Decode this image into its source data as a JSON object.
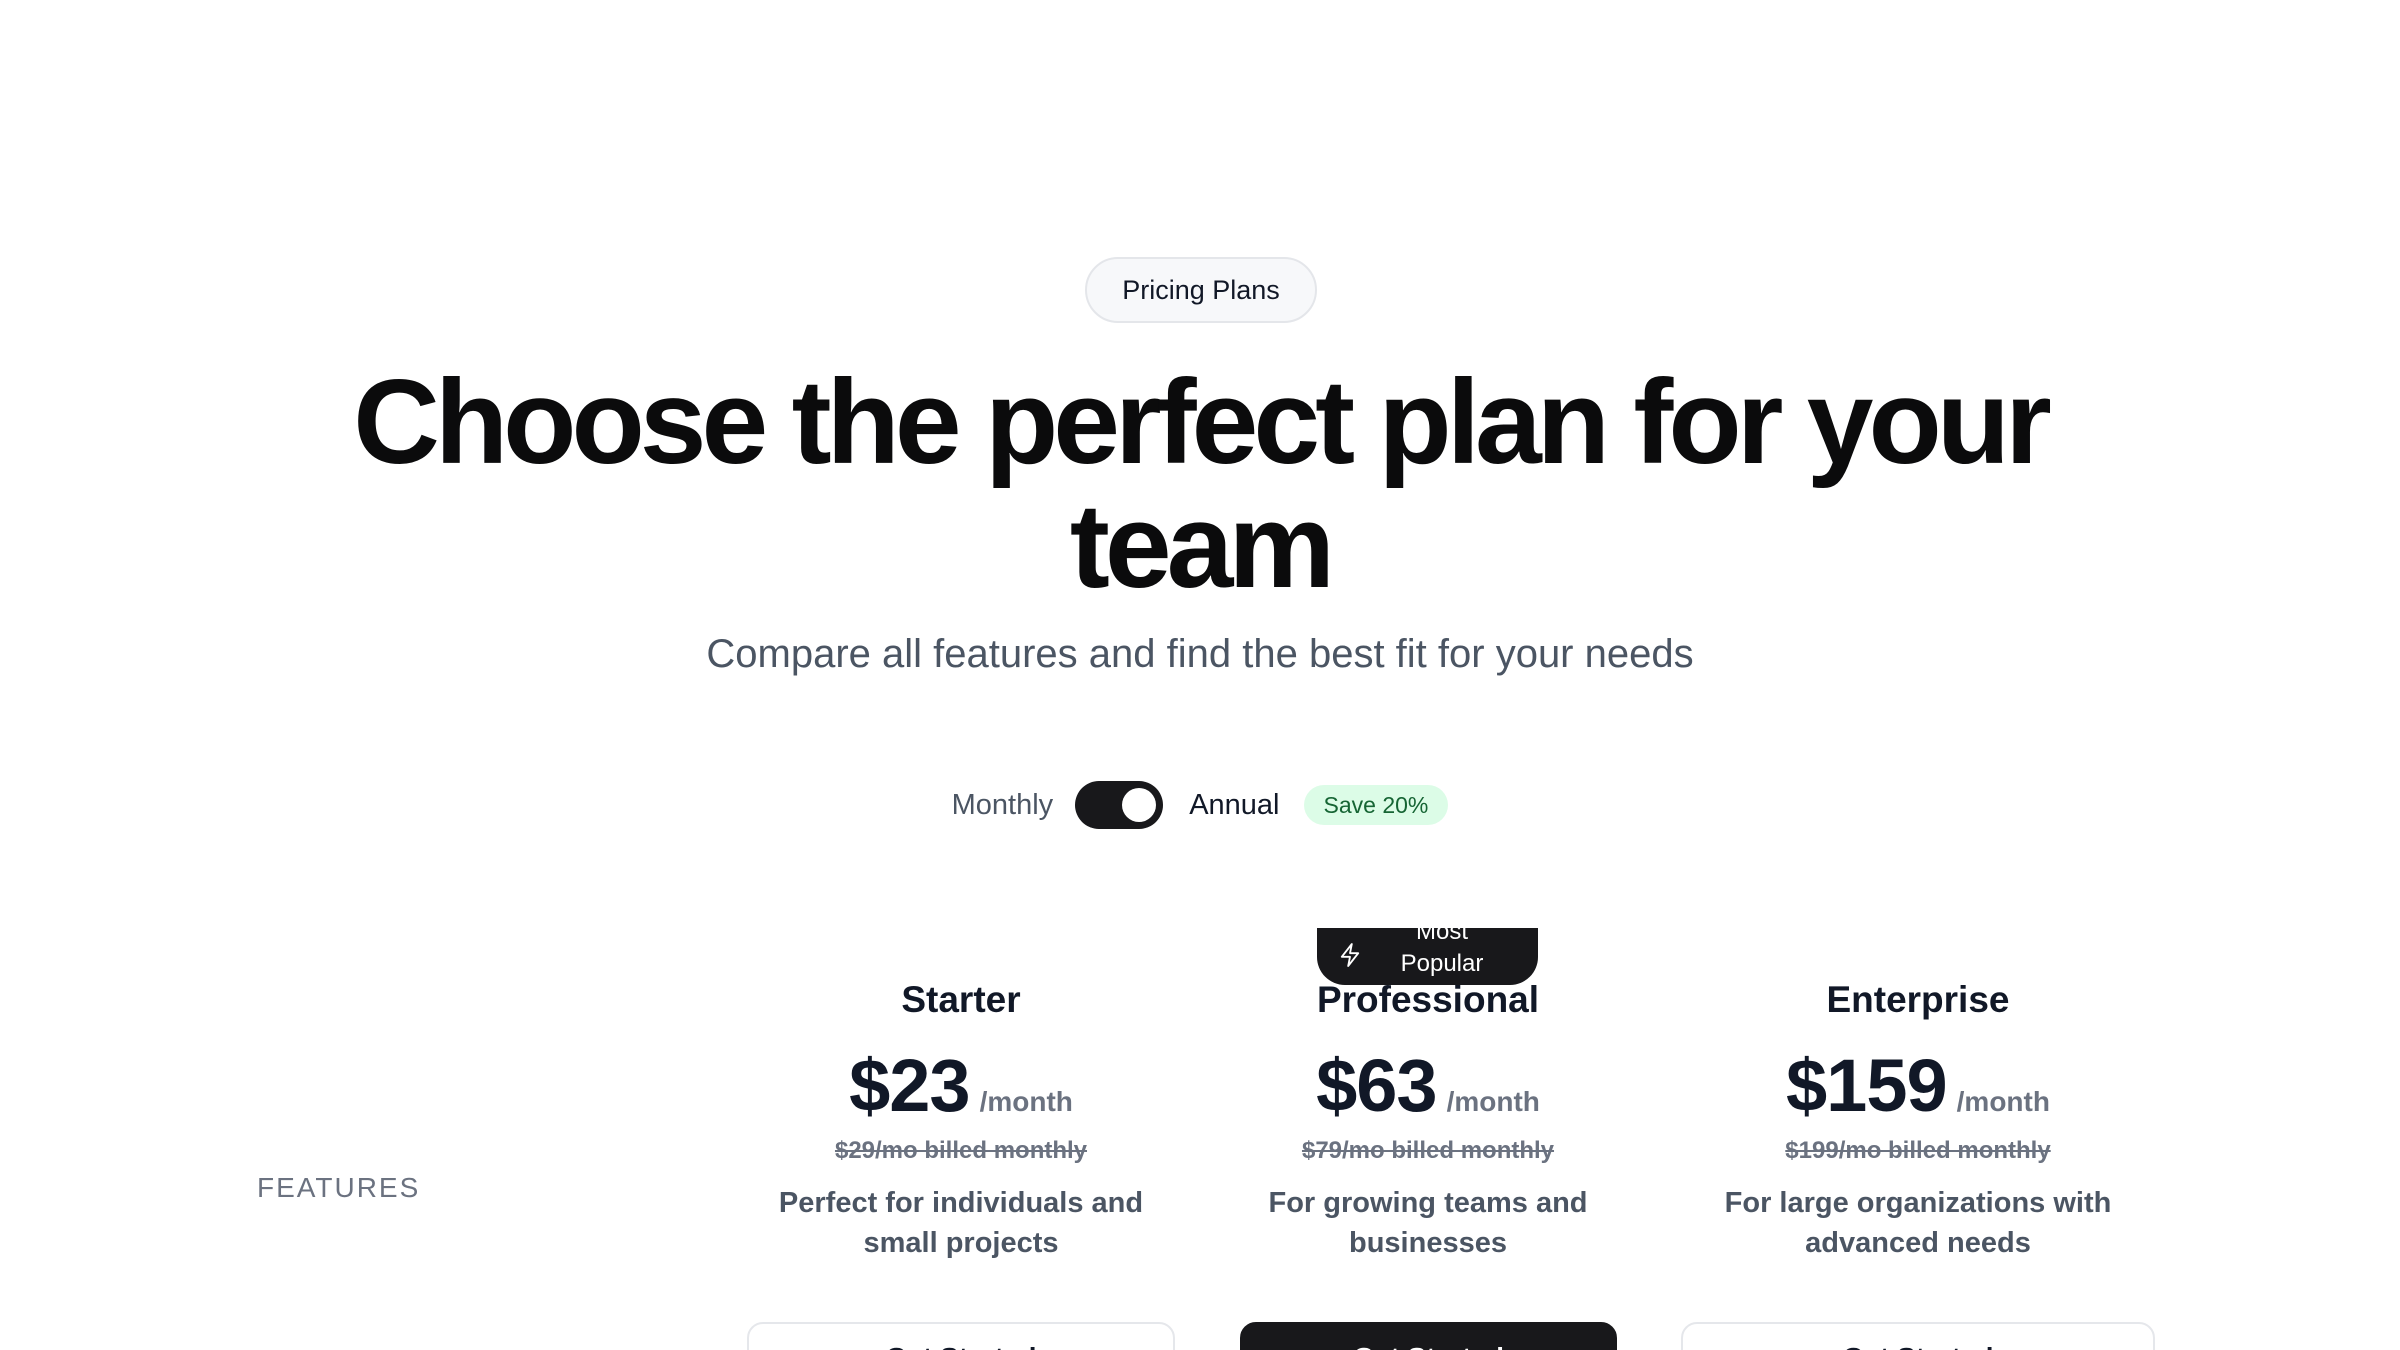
{
  "header": {
    "eyebrow": "Pricing Plans",
    "title": "Choose the perfect plan for your team",
    "subtitle": "Compare all features and find the best fit for your needs"
  },
  "billing": {
    "monthly_label": "Monthly",
    "annual_label": "Annual",
    "save_badge": "Save 20%",
    "selected": "Annual"
  },
  "table": {
    "features_label": "FEATURES"
  },
  "badge": {
    "popular_label": "Most Popular",
    "icon": "lightning-icon"
  },
  "plans": [
    {
      "name": "Starter",
      "price": "$23",
      "period": "/month",
      "old_price": "$29/mo billed monthly",
      "description": "Perfect for individuals and small projects",
      "cta": "Get Started"
    },
    {
      "name": "Professional",
      "price": "$63",
      "period": "/month",
      "old_price": "$79/mo billed monthly",
      "description": "For growing teams and businesses",
      "cta": "Get Started"
    },
    {
      "name": "Enterprise",
      "price": "$159",
      "period": "/month",
      "old_price": "$199/mo billed monthly",
      "description": "For large organizations with advanced needs",
      "cta": "Get Started"
    }
  ],
  "colors": {
    "primary": "#18181b",
    "save_badge_bg": "#dcfce7",
    "save_badge_text": "#166534",
    "muted_text": "#6b7280"
  }
}
